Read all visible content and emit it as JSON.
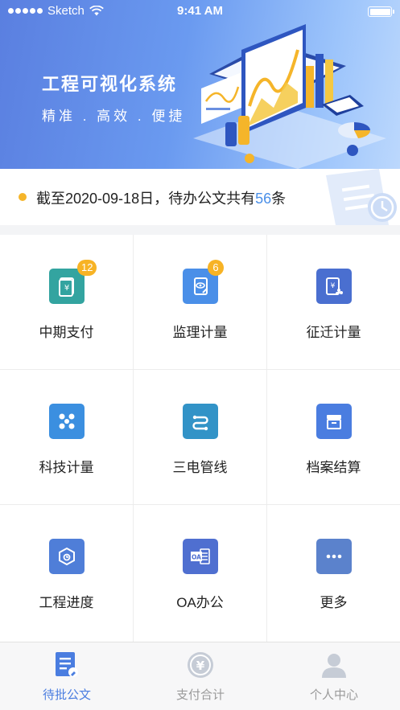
{
  "status_bar": {
    "carrier": "Sketch",
    "time": "9:41 AM"
  },
  "hero": {
    "title": "工程可视化系统",
    "subtitle": "精准 . 高效 . 便捷"
  },
  "notice": {
    "prefix": "截至2020-09-18日，待办公文共有",
    "count": "56",
    "suffix": "条"
  },
  "grid": [
    {
      "label": "中期支付",
      "icon": "payment-icon",
      "badge": "12",
      "color": "#33a4a0"
    },
    {
      "label": "监理计量",
      "icon": "supervision-icon",
      "badge": "6",
      "color": "#4a8fe8"
    },
    {
      "label": "征迁计量",
      "icon": "relocation-icon",
      "badge": "",
      "color": "#4a6fd0"
    },
    {
      "label": "科技计量",
      "icon": "tech-icon",
      "badge": "",
      "color": "#3b8fe0"
    },
    {
      "label": "三电管线",
      "icon": "pipeline-icon",
      "badge": "",
      "color": "#3293c7"
    },
    {
      "label": "档案结算",
      "icon": "archive-icon",
      "badge": "",
      "color": "#4a7de0"
    },
    {
      "label": "工程进度",
      "icon": "progress-icon",
      "badge": "",
      "color": "#4f7ed8"
    },
    {
      "label": "OA办公",
      "icon": "oa-icon",
      "badge": "",
      "color": "#4f6fd0"
    },
    {
      "label": "更多",
      "icon": "more-icon",
      "badge": "",
      "color": "#5b82cc"
    }
  ],
  "tabs": [
    {
      "label": "待批公文",
      "icon": "document-tab-icon",
      "active": true
    },
    {
      "label": "支付合计",
      "icon": "coin-tab-icon",
      "active": false
    },
    {
      "label": "个人中心",
      "icon": "user-tab-icon",
      "active": false
    }
  ],
  "colors": {
    "accent": "#4a7de0",
    "badge": "#f7b325",
    "count": "#4a8fe8"
  }
}
